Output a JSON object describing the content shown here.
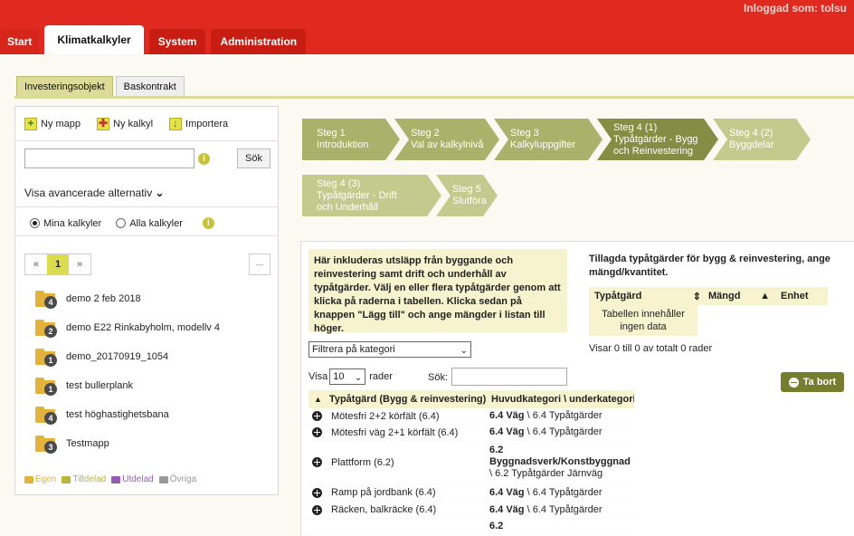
{
  "header": {
    "logged_in": "Inloggad som: tolsu",
    "tabs": [
      {
        "label": "Start"
      },
      {
        "label": "Klimatkalkyler"
      },
      {
        "label": "System"
      },
      {
        "label": "Administration"
      }
    ],
    "active_tab": 1,
    "brand_color": "#e02a1f"
  },
  "subtabs": [
    {
      "label": "Investeringsobjekt"
    },
    {
      "label": "Baskontrakt"
    }
  ],
  "left": {
    "actions": [
      {
        "label": "Ny mapp",
        "icon": "add-folder-icon"
      },
      {
        "label": "Ny kalkyl",
        "icon": "new-calc-icon"
      },
      {
        "label": "Importera",
        "icon": "import-icon"
      }
    ],
    "search_button": "Sök",
    "advanced": "Visa avancerade alternativ",
    "radio_mine": "Mina kalkyler",
    "radio_all": "Alla kalkyler",
    "pager": {
      "prev": "«",
      "page": "1",
      "next": "»",
      "more": "..."
    },
    "folders": [
      {
        "name": "demo 2 feb 2018",
        "count": "4"
      },
      {
        "name": "demo E22 Rinkabyholm, modellv 4",
        "count": "2"
      },
      {
        "name": "demo_20170919_1054",
        "count": "1"
      },
      {
        "name": "test bullerplank",
        "count": "1"
      },
      {
        "name": "test höghastighetsbana",
        "count": "4"
      },
      {
        "name": "Testmapp",
        "count": "3"
      }
    ],
    "legend": [
      {
        "label": "Egen",
        "color": "#e3b23c"
      },
      {
        "label": "Tilldelad",
        "color": "#b7b53a"
      },
      {
        "label": "Utdelad",
        "color": "#9b59b6"
      },
      {
        "label": "Övriga",
        "color": "#9a9a9a"
      }
    ]
  },
  "steps": [
    {
      "line1": "Steg 1",
      "line2": "Introduktion",
      "line3": ""
    },
    {
      "line1": "Steg 2",
      "line2": "Val av kalkylnivå",
      "line3": ""
    },
    {
      "line1": "Steg 3",
      "line2": "Kalkyluppgifter",
      "line3": ""
    },
    {
      "line1": "Steg 4 (1)",
      "line2": "Typåtgärder - Bygg",
      "line3": "och Reinvestering"
    },
    {
      "line1": "Steg 4 (2)",
      "line2": "Byggdelar",
      "line3": ""
    },
    {
      "line1": "Steg 4 (3)",
      "line2": "Typåtgärder - Drift",
      "line3": "och Underhåll"
    },
    {
      "line1": "Steg 5",
      "line2": "Slutföra",
      "line3": ""
    }
  ],
  "main": {
    "intro": "Här inkluderas utsläpp från byggande och reinvestering samt drift och underhåll av typåtgärder. Välj en eller flera typåtgärder genom att klicka på raderna i tabellen. Klicka sedan på knappen \"Lägg till\" och ange mängder i listan till höger.",
    "added_title": "Tillagda typåtgärder för bygg & reinvestering, ange mängd/kvantitet.",
    "added_cols": {
      "c1": "Typåtgärd",
      "c2": "Mängd",
      "c3": "Enhet"
    },
    "empty": "Tabellen innehåller ingen data",
    "showing": "Visar 0 till 0 av totalt 0 rader",
    "filter": "Filtrera på kategori",
    "visa": "Visa",
    "page_len": "10",
    "rader": "rader",
    "sok": "Sök:",
    "remove": "Ta bort",
    "table_cols": {
      "c1": "Typåtgärd (Bygg & reinvestering)",
      "c2": "Huvudkategori \\ underkategori"
    },
    "rows": [
      {
        "name": "Mötesfri 2+2 körfält (6.4)",
        "cat_bold": "6.4 Väg",
        "cat_rest": " \\ 6.4 Typåtgärder"
      },
      {
        "name": "Mötesfri väg 2+1 körfält (6.4)",
        "cat_bold": "6.4 Väg",
        "cat_rest": " \\ 6.4 Typåtgärder"
      },
      {
        "name": "Plattform (6.2)",
        "cat_bold": "6.2 Byggnadsverk/Konstbyggnad",
        "cat_rest": " \\ 6.2 Typåtgärder Järnväg"
      },
      {
        "name": "Ramp på jordbank (6.4)",
        "cat_bold": "6.4 Väg",
        "cat_rest": " \\ 6.4 Typåtgärder"
      },
      {
        "name": "Räcken, balkräcke (6.4)",
        "cat_bold": "6.4 Väg",
        "cat_rest": " \\ 6.4 Typåtgärder"
      },
      {
        "name": "",
        "cat_bold": "6.2",
        "cat_rest": ""
      }
    ]
  }
}
